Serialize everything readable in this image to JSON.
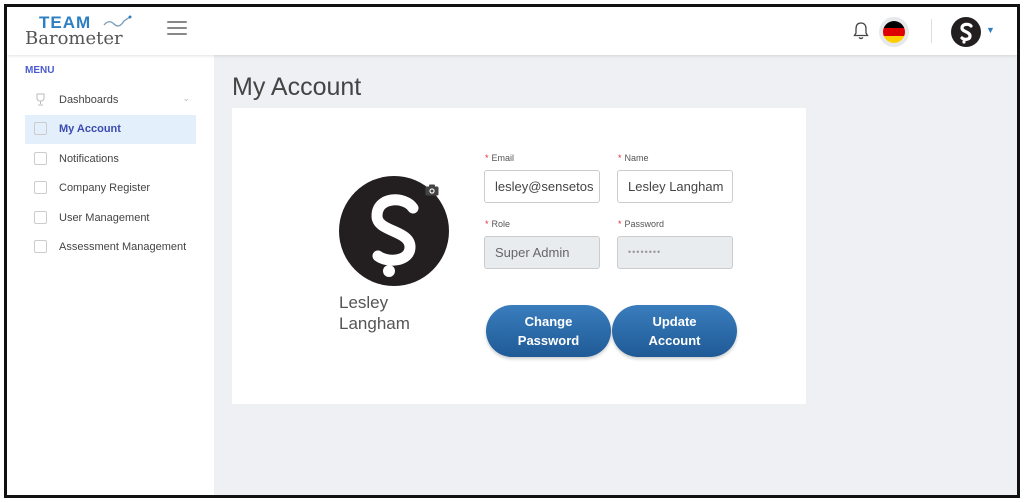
{
  "header": {
    "logo_team": "TEAM",
    "logo_barometer": "Barometer",
    "icons": {
      "menu": "hamburger-icon",
      "bell": "bell-icon",
      "language": "germany-flag-icon",
      "user": "user-avatar-icon",
      "caret": "caret-down-icon"
    }
  },
  "sidebar": {
    "menu_label": "MENU",
    "items": [
      {
        "label": "Dashboards",
        "icon": "trophy-icon",
        "has_chevron": true
      },
      {
        "label": "My Account",
        "icon": "square-icon",
        "active": true
      },
      {
        "label": "Notifications",
        "icon": "square-icon"
      },
      {
        "label": "Company Register",
        "icon": "square-icon"
      },
      {
        "label": "User Management",
        "icon": "square-icon"
      },
      {
        "label": "Assessment Management",
        "icon": "square-icon"
      }
    ]
  },
  "main": {
    "title": "My Account",
    "profile": {
      "name_line1": "Lesley",
      "name_line2": "Langham",
      "camera_icon": "camera-icon"
    },
    "form": {
      "email_label": "Email",
      "email_value": "lesley@sensetos",
      "name_label": "Name",
      "name_value": "Lesley Langham",
      "role_label": "Role",
      "role_value": "Super Admin",
      "password_label": "Password",
      "password_value": "••••••••",
      "required_mark": "*"
    },
    "buttons": {
      "change_password_line1": "Change",
      "change_password_line2": "Password",
      "update_account_line1": "Update",
      "update_account_line2": "Account"
    }
  },
  "colors": {
    "accent": "#2d7fc1",
    "button": "#1f5a96",
    "active_bg": "#e3effb",
    "required": "#e03131"
  }
}
